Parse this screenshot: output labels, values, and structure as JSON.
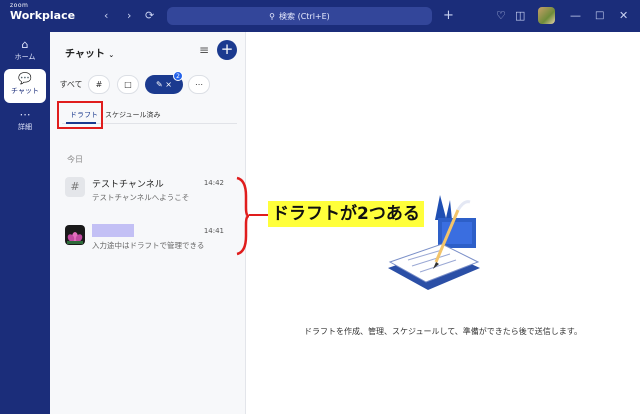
{
  "app": {
    "brand_top": "zoom",
    "brand_main": "Workplace"
  },
  "titlebar": {
    "search_label": "検索 (Ctrl+E)",
    "icons": [
      "back-arrow-icon",
      "forward-arrow-icon",
      "history-icon",
      "search-icon",
      "plus-icon",
      "bell-icon",
      "notes-icon",
      "avatar",
      "minimize-icon",
      "maximize-icon",
      "close-icon"
    ]
  },
  "rail": {
    "items": [
      {
        "label": "ホーム",
        "icon": "home-icon"
      },
      {
        "label": "チャット",
        "icon": "chat-icon",
        "active": true
      },
      {
        "label": "詳細",
        "icon": "more-icon"
      }
    ]
  },
  "chat_panel": {
    "title": "チャット",
    "filters": {
      "all_label": "すべて",
      "draft_badge": "2"
    },
    "tabs": {
      "draft": "ドラフト",
      "scheduled": "スケジュール済み"
    },
    "section_label": "今日",
    "rows": [
      {
        "name": "テストチャンネル",
        "time": "14:42",
        "preview": "テストチャンネルへようこそ"
      },
      {
        "name": "",
        "time": "14:41",
        "preview": "入力途中はドラフトで管理できる"
      }
    ]
  },
  "main": {
    "callout": "ドラフトが2つある",
    "empty_message": "ドラフトを作成、管理、スケジュールして、準備ができたら後で送信します。"
  },
  "colors": {
    "brand_navy": "#1b2d7a",
    "accent_blue": "#1b3a8f",
    "highlight_red": "#e01d1d",
    "highlight_yellow": "#ffff3b"
  }
}
